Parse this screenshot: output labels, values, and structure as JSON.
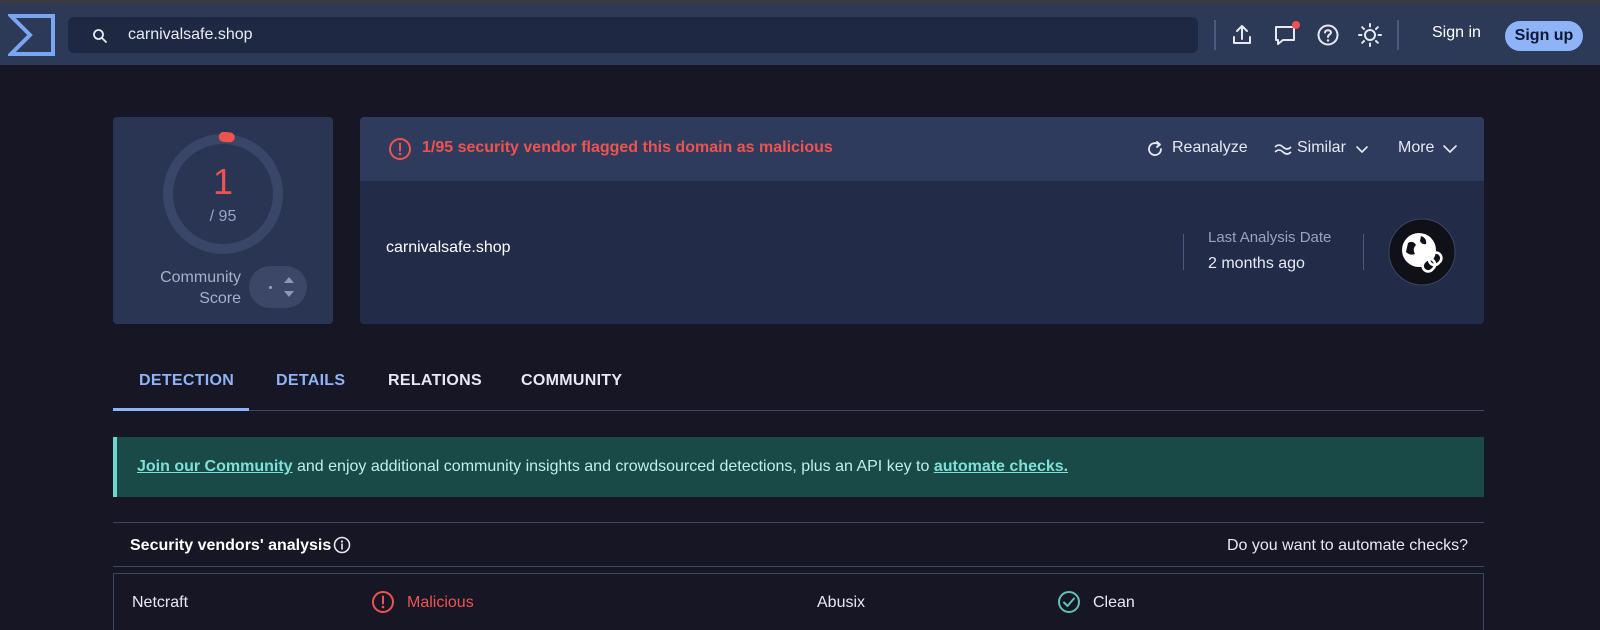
{
  "header": {
    "search_value": "carnivalsafe.shop",
    "sign_in": "Sign in",
    "sign_up": "Sign up",
    "icons": [
      "upload-icon",
      "chat-icon",
      "help-icon",
      "theme-icon"
    ],
    "notification_dot_color": "#ef5350"
  },
  "score": {
    "detections": "1",
    "total": "/ 95",
    "community_label_line1": "Community",
    "community_label_line2": "Score",
    "ring_fraction": 0.0105
  },
  "summary": {
    "alert": "1/95 security vendor flagged this domain as malicious",
    "actions": {
      "reanalyze": "Reanalyze",
      "similar": "Similar",
      "more": "More"
    },
    "domain": "carnivalsafe.shop",
    "last_analysis_label": "Last Analysis Date",
    "last_analysis_value": "2 months ago"
  },
  "tabs": [
    "DETECTION",
    "DETAILS",
    "RELATIONS",
    "COMMUNITY"
  ],
  "banner": {
    "link1": "Join our Community",
    "middle": " and enjoy additional community insights and crowdsourced detections, plus an API key to ",
    "link2": "automate checks."
  },
  "vendors": {
    "title": "Security vendors' analysis",
    "automate": "Do you want to automate checks?",
    "rows": [
      {
        "vendor1": "Netcraft",
        "status1": "Malicious",
        "vendor2": "Abusix",
        "status2": "Clean"
      }
    ]
  },
  "colors": {
    "malicious": "#ef5350",
    "clean": "#5fc3b4",
    "accent": "#8fb3f7"
  }
}
